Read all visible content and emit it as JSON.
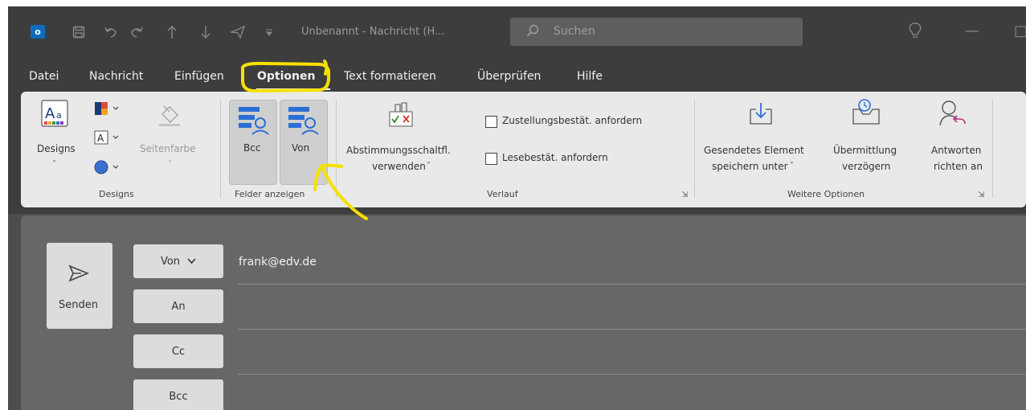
{
  "titlebar": {
    "doc_title": "Unbenannt - Nachricht (H...",
    "search_placeholder": "Suchen",
    "minimize_glyph": "—",
    "clipped_glyph": "□"
  },
  "menu": {
    "items": [
      "Datei",
      "Nachricht",
      "Einfügen",
      "Optionen",
      "Text formatieren",
      "Überprüfen",
      "Hilfe"
    ],
    "active": "Optionen"
  },
  "ribbon": {
    "designs": {
      "designs_label": "Designs",
      "page_color_label": "Seitenfarbe",
      "group_label": "Designs"
    },
    "felder": {
      "bcc_label": "Bcc",
      "von_label": "Von",
      "group_label": "Felder anzeigen"
    },
    "verlauf": {
      "vote_label_1": "Abstimmungsschaltfl.",
      "vote_label_2": "verwenden",
      "delivery_receipt": "Zustellungsbestät. anfordern",
      "read_receipt": "Lesebestät. anfordern",
      "group_label": "Verlauf"
    },
    "weitere": {
      "save_sent_1": "Gesendetes Element",
      "save_sent_2": "speichern unter",
      "delay_1": "Übermittlung",
      "delay_2": "verzögern",
      "reply_1": "Antworten",
      "reply_2": "richten an",
      "group_label": "Weitere Optionen"
    }
  },
  "compose": {
    "send_label": "Senden",
    "from_label": "Von",
    "from_value": "frank@edv.de",
    "to_label": "An",
    "cc_label": "Cc",
    "bcc_label": "Bcc"
  },
  "colors": {
    "titlebar_bg": "#3d3d3d",
    "ribbon_bg": "#e9e9e9",
    "compose_bg": "#676767",
    "annotation": "#f5e000",
    "accent_blue": "#0f6cbd"
  }
}
